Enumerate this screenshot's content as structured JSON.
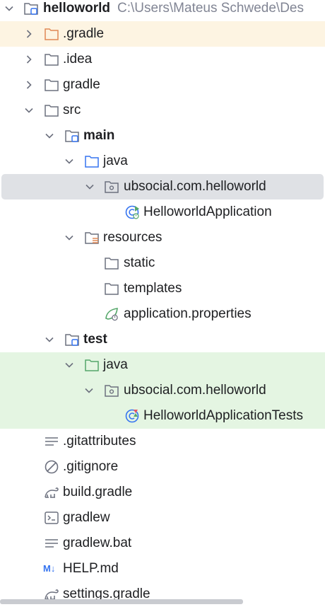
{
  "tree": {
    "root": {
      "label": "helloworld",
      "path": "C:\\Users\\Mateus Schwede\\Des"
    },
    "items": [
      {
        "label": ".gradle"
      },
      {
        "label": ".idea"
      },
      {
        "label": "gradle"
      },
      {
        "label": "src"
      },
      {
        "label": "main"
      },
      {
        "label": "java"
      },
      {
        "label": "ubsocial.com.helloworld"
      },
      {
        "label": "HelloworldApplication"
      },
      {
        "label": "resources"
      },
      {
        "label": "static"
      },
      {
        "label": "templates"
      },
      {
        "label": "application.properties"
      },
      {
        "label": "test"
      },
      {
        "label": "java"
      },
      {
        "label": "ubsocial.com.helloworld"
      },
      {
        "label": "HelloworldApplicationTests"
      },
      {
        "label": ".gitattributes"
      },
      {
        "label": ".gitignore"
      },
      {
        "label": "build.gradle"
      },
      {
        "label": "gradlew"
      },
      {
        "label": "gradlew.bat"
      },
      {
        "label": "HELP.md"
      },
      {
        "label": "settings.gradle"
      }
    ],
    "markdown_badge": "M↓"
  },
  "colors": {
    "gradle_highlight": "#fdf4e2",
    "selection": "#dfe1e5",
    "test_highlight": "#e4f5e2",
    "folder_blue": "#3574f0",
    "folder_test_green": "#55a76a",
    "gradle_orange": "#e08855"
  }
}
